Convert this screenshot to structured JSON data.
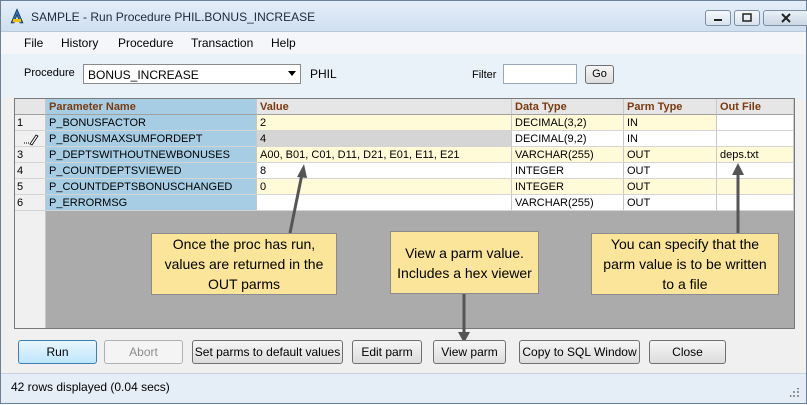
{
  "window": {
    "title": "SAMPLE - Run Procedure PHIL.BONUS_INCREASE"
  },
  "menu": [
    "File",
    "History",
    "Procedure",
    "Transaction",
    "Help"
  ],
  "toolbar": {
    "procedure_label": "Procedure",
    "procedure_value": "BONUS_INCREASE",
    "schema": "PHIL",
    "filter_label": "Filter",
    "filter_value": "",
    "go_label": "Go"
  },
  "grid": {
    "columns": [
      "Parameter Name",
      "Value",
      "Data Type",
      "Parm Type",
      "Out File"
    ],
    "rows": [
      {
        "num": "1",
        "name": "P_BONUSFACTOR",
        "value": "2",
        "type": "DECIMAL(3,2)",
        "parm": "IN",
        "out": ""
      },
      {
        "num": "",
        "name": "P_BONUSMAXSUMFORDEPT",
        "value": "4",
        "type": "DECIMAL(9,2)",
        "parm": "IN",
        "out": ""
      },
      {
        "num": "3",
        "name": "P_DEPTSWITHOUTNEWBONUSES",
        "value": "A00, B01, C01, D11, D21, E01, E11, E21",
        "type": "VARCHAR(255)",
        "parm": "OUT",
        "out": "deps.txt"
      },
      {
        "num": "4",
        "name": "P_COUNTDEPTSVIEWED",
        "value": "8",
        "type": "INTEGER",
        "parm": "OUT",
        "out": ""
      },
      {
        "num": "5",
        "name": "P_COUNTDEPTSBONUSCHANGED",
        "value": "0",
        "type": "INTEGER",
        "parm": "OUT",
        "out": ""
      },
      {
        "num": "6",
        "name": "P_ERRORMSG",
        "value": "",
        "type": "VARCHAR(255)",
        "parm": "OUT",
        "out": ""
      }
    ]
  },
  "callouts": {
    "out_parms": "Once the proc has run, values are returned in the OUT parms",
    "view_parm": "View a parm value. Includes a hex viewer",
    "out_file": "You can specify that the parm value is to be written to a file"
  },
  "buttons": {
    "run": "Run",
    "abort": "Abort",
    "defaults": "Set parms to default values",
    "edit": "Edit parm",
    "view": "View parm",
    "copy": "Copy to SQL Window",
    "close": "Close"
  },
  "status": {
    "text": "42 rows displayed (0.04 secs)"
  },
  "colors": {
    "header_text": "#7b3a10",
    "param_name_bg": "#a7cde5",
    "yellow_row": "#fffad7",
    "callout_bg": "#fbe59a"
  }
}
